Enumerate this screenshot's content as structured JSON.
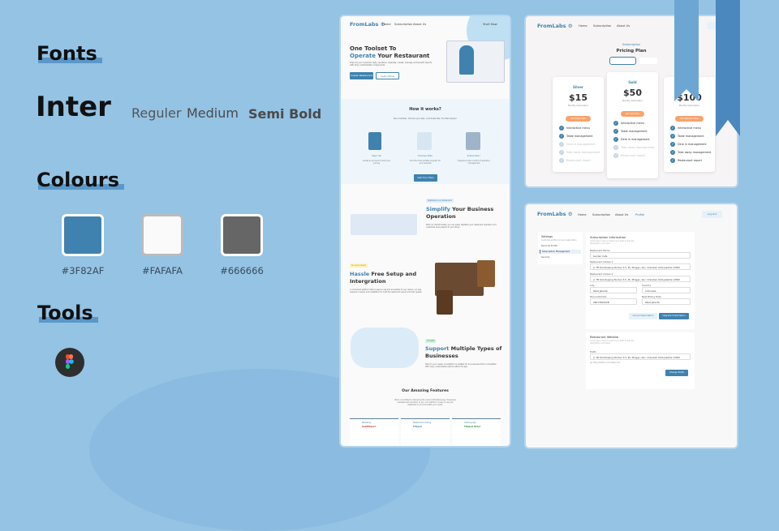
{
  "left": {
    "fonts_heading": "Fonts",
    "font_name": "Inter",
    "weights": [
      "Reguler",
      "Medium",
      "Semi Bold"
    ],
    "colours_heading": "Colours",
    "colours": [
      {
        "hex": "#3F82AF",
        "label": "#3F82AF"
      },
      {
        "hex": "#FAFAFA",
        "label": "#FAFAFA"
      },
      {
        "hex": "#666666",
        "label": "#666666"
      }
    ],
    "tools_heading": "Tools",
    "tool_icon": "figma-icon"
  },
  "landing": {
    "logo": "FromLabs",
    "logo_sub": "SOLUTIONS",
    "nav": [
      "Home",
      "Subscription",
      "About Us"
    ],
    "start_now": "Start Now",
    "hero_title_1": "One Toolset To",
    "hero_accent": "Operate",
    "hero_title_2": "Your Restaurant",
    "hero_desc": "Improve your business daily operation. Operate, create, manage and benefit reports with fully customizable components.",
    "create_btn": "Create Restaurant",
    "learn_btn": "Learn More",
    "how_title": "How it works?",
    "how_sub": "Be a member, Choose your plan, and Subscribe. It's that simple!",
    "steps": [
      {
        "title": "Sign Up",
        "desc": "Create an account to start your journey"
      },
      {
        "title": "Choose Plan",
        "desc": "Find the most suitable program for your business"
      },
      {
        "title": "Subscribe !",
        "desc": "Experience the comfort of operation management"
      }
    ],
    "get_plan": "Get Your Plan",
    "s1_tag": "Digitalized your Restaurant",
    "s1_accent": "Simplify",
    "s1_title": "Your Business Operation",
    "s1_desc": "With our robust toolset, you can easily digitalize your restaurant operation and customize every aspect to your liking.",
    "s2_tag": "No setup hassle!",
    "s2_accent": "Hassle",
    "s2_title": "Free Setup and Intergration",
    "s2_desc": "A convenient platform that is easy to use and accessible for any device, our app requires no setup and installation for both the restaurant owner and their guests.",
    "s3_tag": "Versatile",
    "s3_accent": "Support",
    "s3_title": "Multiple Types of Businesses",
    "s3_desc": "Tailor to your needs, our platform is suitable for any business that is compatible with many customizable options within the app.",
    "features_title": "Our Amazing Features",
    "features_desc": "We're committed to delivering the most comfortable way of business management operation to you. Our platform is easy to use and adaptable to accommodate your needs.",
    "features": [
      {
        "tag": "Marketing",
        "name": "SeaMiSport"
      },
      {
        "tag": "Restaurant & Dining",
        "name": "Fifapod"
      },
      {
        "tag": "Ordering App",
        "name": "Fifapod Order"
      }
    ]
  },
  "pricing": {
    "logo": "FromLabs",
    "nav": [
      "Home",
      "Subscription",
      "About Us"
    ],
    "signin": "Sign",
    "subtitle": "Subscription",
    "title": "Pricing Plan",
    "plans": [
      {
        "name": "Silver",
        "price": "$15",
        "period": "Monthly Subscription",
        "button": "Get Silver Plan",
        "enabled": 2
      },
      {
        "name": "Gold",
        "price": "$50",
        "period": "Monthly Subscription",
        "button": "Get Gold Plan",
        "enabled": 3
      },
      {
        "name": "",
        "price": "$100",
        "period": "Monthly Subscription",
        "button": "Get Platinum Plan",
        "enabled": 5
      }
    ],
    "features": [
      "Interactive menu",
      "Table management",
      "Dine in management",
      "Take away management",
      "Restaurant report"
    ]
  },
  "settings": {
    "logo": "FromLabs",
    "nav": [
      "Home",
      "Subscription",
      "About Us",
      "Profile"
    ],
    "logout": "Log Out",
    "side_title": "Settings",
    "side_desc": "Customize profile and your subscription",
    "side_items": [
      "Personal Profile",
      "Subscription Management",
      "Security"
    ],
    "sub_title": "Subscription Information",
    "sub_desc": "Lorem ipsum dolor si amet if you want to add any description, put it here.",
    "fields": {
      "name": {
        "label": "Restaurant Name",
        "value": "Garden Cafe"
      },
      "addr1": {
        "label": "Restaurant Adress 1",
        "value": "Jl. TB Simatupang No.Kav 3-5, Ps. Minggu, Kec. Cilandak, Kota Jakarta 12560"
      },
      "addr2": {
        "label": "Restaurant Adress 2",
        "value": "Jl. TB Simatupang No.Kav 3-5, Ps. Minggu, Kec. Cilandak, Kota Jakarta 12560"
      },
      "city": {
        "label": "City",
        "value": "West Jakarta"
      },
      "country": {
        "label": "Country",
        "value": "Indonesia"
      },
      "phone": {
        "label": "Phone Number",
        "value": "0827362002B"
      },
      "billing": {
        "label": "Next Billing Date",
        "value": "West Jakarta"
      }
    },
    "cancel": "Cancel Subscription",
    "upgrade": "Upgrade Subscription",
    "web_title": "Restaurant Website",
    "web_desc": "Lorem ipsum dolor si amet if you want to add any description, put it here.",
    "prefix_label": "Prefix",
    "prefix_value": "Jl. TB Simatupang No.Kav 3-5, Ps. Minggu, Kec. Cilandak, Kota Jakarta 12560",
    "prefix_hint": "eg: https://Prefix.vn.fromlabs.com",
    "change_prefix": "Change Prefix"
  }
}
